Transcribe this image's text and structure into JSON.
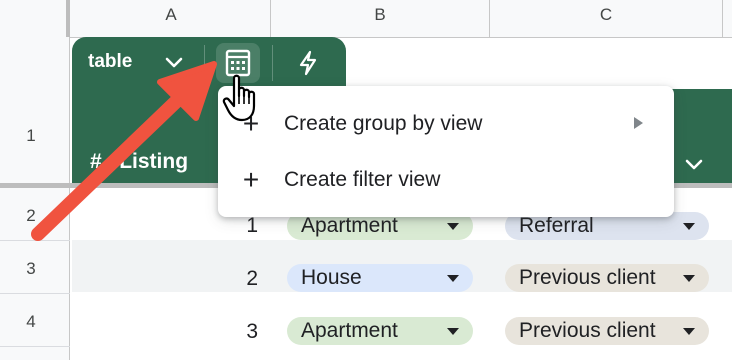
{
  "columns": [
    "A",
    "B",
    "C"
  ],
  "rows": [
    "1",
    "2",
    "3",
    "4"
  ],
  "table": {
    "name": "table",
    "column_title": "Listing",
    "column_prefix": "#"
  },
  "menu": {
    "items": [
      {
        "label": "Create group by view",
        "has_submenu": true
      },
      {
        "label": "Create filter view",
        "has_submenu": false
      }
    ]
  },
  "data_rows": [
    {
      "num": "1",
      "type": "Apartment",
      "source": "Referral"
    },
    {
      "num": "2",
      "type": "House",
      "source": "Previous client"
    },
    {
      "num": "3",
      "type": "Apartment",
      "source": "Previous client"
    }
  ],
  "colors": {
    "table_green": "#2e6a4f",
    "pill_apartment": "#d9ead3",
    "pill_house": "#dbe7fb",
    "pill_referral": "#dde3ef",
    "pill_previous_client": "#e8e4dc",
    "annotation_arrow": "#f0533f"
  },
  "icons": [
    "chevron-down-icon",
    "calculator-icon",
    "bolt-icon",
    "hand-cursor-icon",
    "plus-icon",
    "submenu-arrow-icon"
  ]
}
